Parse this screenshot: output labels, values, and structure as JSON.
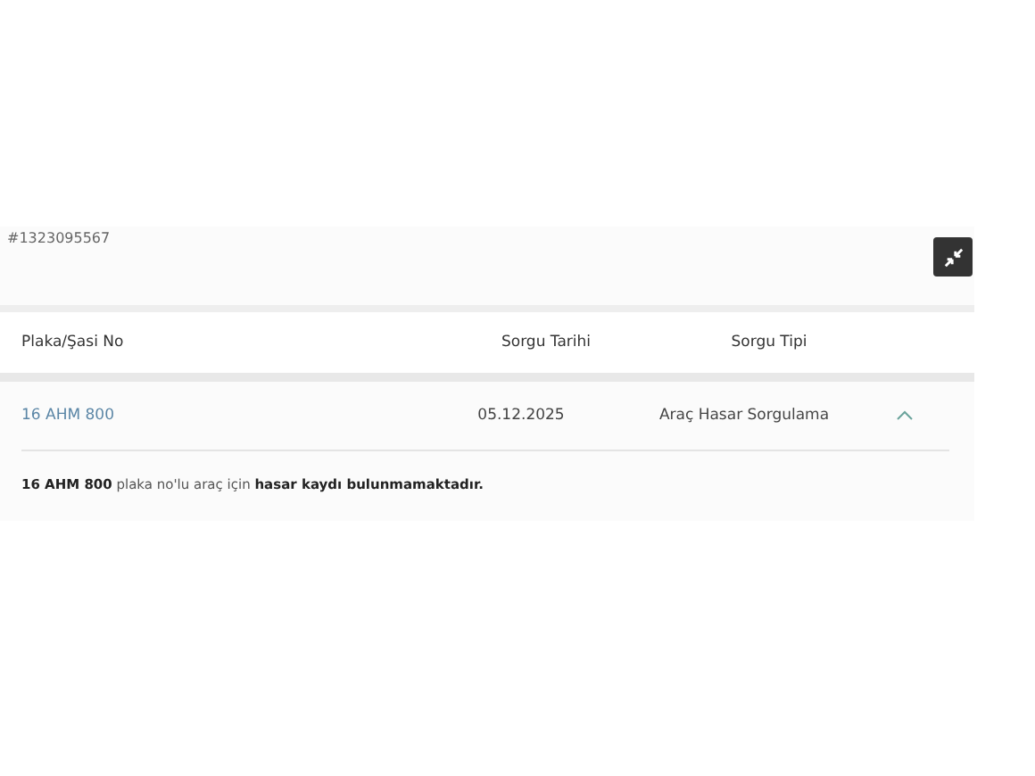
{
  "record_id": "#1323095567",
  "table": {
    "columns": [
      "Plaka/Şasi No",
      "Sorgu Tarihi",
      "Sorgu Tipi"
    ],
    "rows": [
      {
        "plate": "16 AHM 800",
        "date": "05.12.2025",
        "type": "Araç Hasar Sorgulama",
        "expanded": true
      }
    ]
  },
  "result_message": "**16 AHM 800** plaka no'lu araç için **hasar kaydı bulunmamaktadır.**"
}
